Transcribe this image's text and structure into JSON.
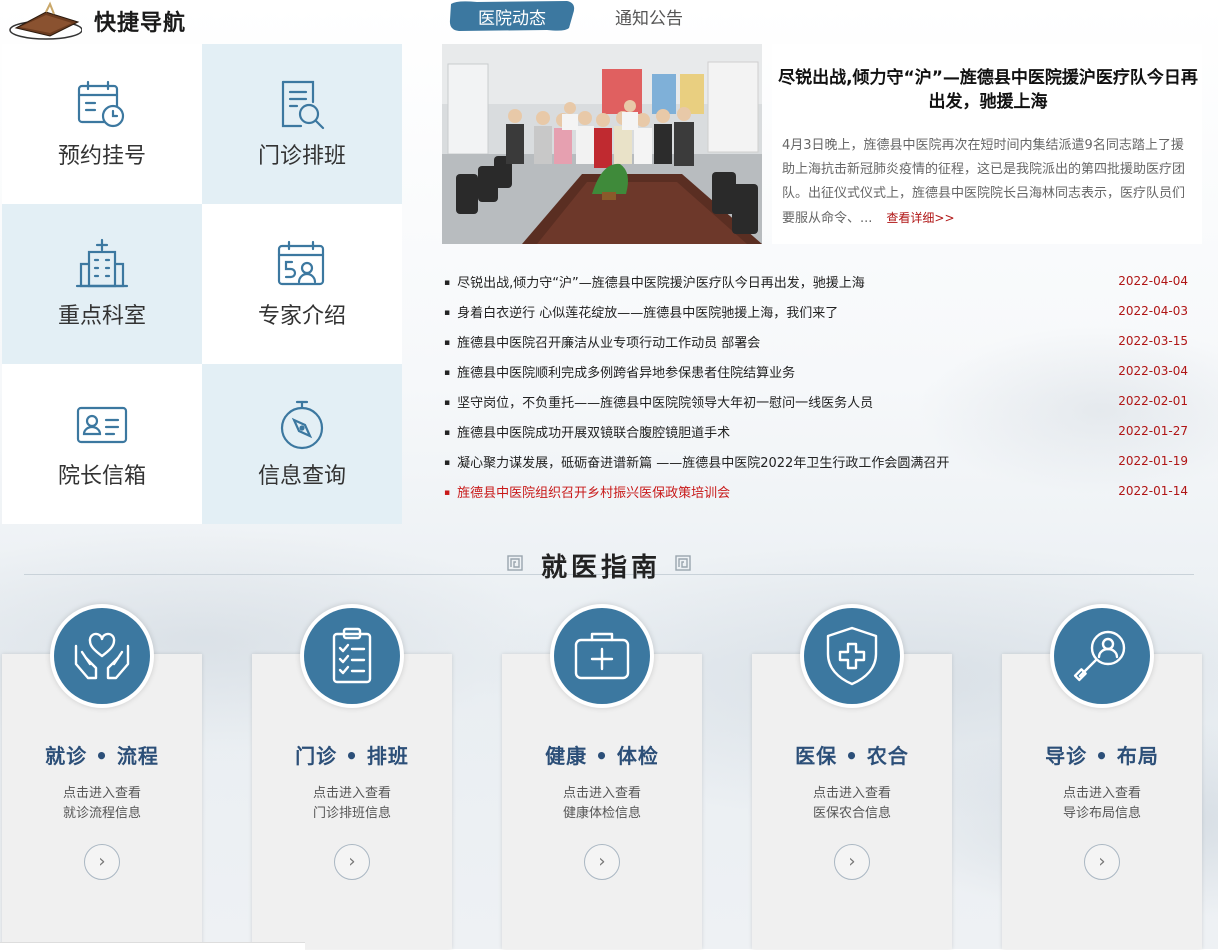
{
  "quick_nav": {
    "title": "快捷导航",
    "items": [
      {
        "label": "预约挂号",
        "icon": "calendar-clock-icon"
      },
      {
        "label": "门诊排班",
        "icon": "document-search-icon"
      },
      {
        "label": "重点科室",
        "icon": "hospital-building-icon"
      },
      {
        "label": "专家介绍",
        "icon": "calendar-expert-icon"
      },
      {
        "label": "院长信箱",
        "icon": "id-card-icon"
      },
      {
        "label": "信息查询",
        "icon": "compass-icon"
      }
    ]
  },
  "tabs": [
    {
      "label": "医院动态",
      "active": true
    },
    {
      "label": "通知公告",
      "active": false
    }
  ],
  "featured": {
    "title": "尽锐出战,倾力守“沪”—旌德县中医院援沪医疗队今日再出发，驰援上海",
    "summary": "4月3日晚上，旌德县中医院再次在短时间内集结派遣9名同志踏上了援助上海抗击新冠肺炎疫情的征程，这已是我院派出的第四批援助医疗团队。出征仪式仪式上，旌德县中医院院长吕海林同志表示，医疗队员们要服从命令、...",
    "more_label": "查看详细>>"
  },
  "news": [
    {
      "title": "尽锐出战,倾力守“沪”—旌德县中医院援沪医疗队今日再出发，驰援上海",
      "date": "2022-04-04"
    },
    {
      "title": "身着白衣逆行 心似莲花绽放——旌德县中医院驰援上海，我们来了",
      "date": "2022-04-03"
    },
    {
      "title": "旌德县中医院召开廉洁从业专项行动工作动员 部署会",
      "date": "2022-03-15"
    },
    {
      "title": "旌德县中医院顺利完成多例跨省异地参保患者住院结算业务",
      "date": "2022-03-04"
    },
    {
      "title": "坚守岗位，不负重托——旌德县中医院院领导大年初一慰问一线医务人员",
      "date": "2022-02-01"
    },
    {
      "title": "旌德县中医院成功开展双镜联合腹腔镜胆道手术",
      "date": "2022-01-27"
    },
    {
      "title": "凝心聚力谋发展，砥砺奋进谱新篇 ——旌德县中医院2022年卫生行政工作会圆满召开",
      "date": "2022-01-19"
    },
    {
      "title": "旌德县中医院组织召开乡村振兴医保政策培训会",
      "date": "2022-01-14"
    }
  ],
  "guide": {
    "title": "就医指南",
    "cards": [
      {
        "title": "就诊 • 流程",
        "desc1": "点击进入查看",
        "desc2": "就诊流程信息",
        "icon": "heart-hands-icon"
      },
      {
        "title": "门诊 • 排班",
        "desc1": "点击进入查看",
        "desc2": "门诊排班信息",
        "icon": "clipboard-checklist-icon"
      },
      {
        "title": "健康 • 体检",
        "desc1": "点击进入查看",
        "desc2": "健康体检信息",
        "icon": "medical-kit-icon"
      },
      {
        "title": "医保 • 农合",
        "desc1": "点击进入查看",
        "desc2": "医保农合信息",
        "icon": "shield-cross-icon"
      },
      {
        "title": "导诊 • 布局",
        "desc1": "点击进入查看",
        "desc2": "导诊布局信息",
        "icon": "person-search-icon"
      }
    ],
    "arrow_symbol": "›"
  },
  "colors": {
    "accent": "#3c78a0",
    "nav_blue_cell": "#e3eff5",
    "date_red": "#b01515",
    "card_title": "#2c4f78"
  }
}
